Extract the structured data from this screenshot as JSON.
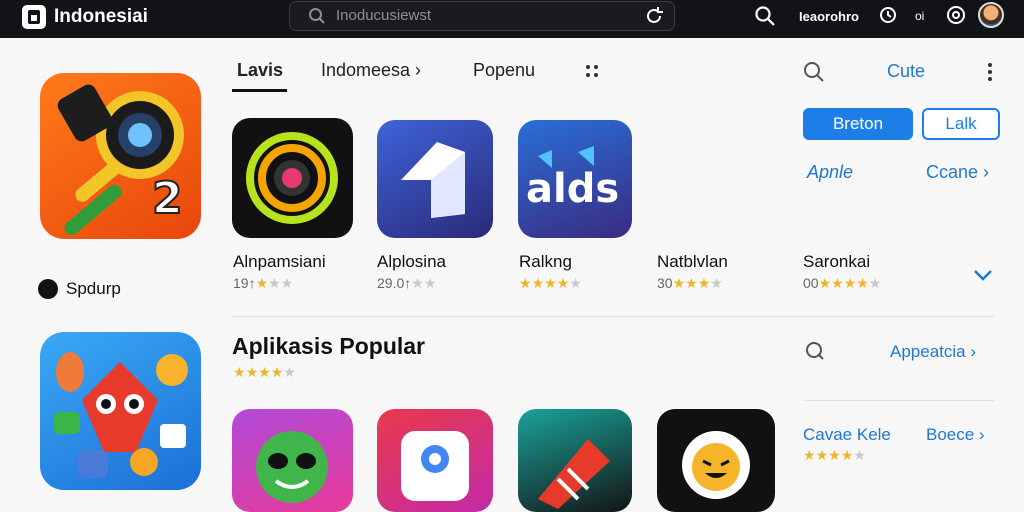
{
  "header": {
    "brand": "Indonesiai",
    "search_placeholder": "Inoducusiewst",
    "user_label": "Ieaorohro",
    "tiny_label": "oi"
  },
  "featured": {
    "sponsor_label": "Spdurp"
  },
  "tabs": [
    {
      "label": "Lavis",
      "active": true
    },
    {
      "label": "Indomeesa ›",
      "active": false
    },
    {
      "label": "Popenu",
      "active": false
    }
  ],
  "actions": {
    "cute_label": "Cute",
    "primary_button": "Breton",
    "secondary_button": "Lalk",
    "apple_link": "Apnle",
    "ccane_link": "Ccane ›"
  },
  "apps": [
    {
      "name": "Alnpamsiani",
      "rating_text": "19↑",
      "stars": 1,
      "max_stars": 3
    },
    {
      "name": "Alplosina",
      "rating_text": "29.0↑",
      "stars": 0,
      "max_stars": 2
    },
    {
      "name": "Ralkng",
      "rating_text": "",
      "stars": 4,
      "max_stars": 5
    },
    {
      "name": "Natblvlan",
      "rating_text": "30",
      "stars": 3,
      "max_stars": 4
    },
    {
      "name": "Saronkai",
      "rating_text": "00",
      "stars": 4,
      "max_stars": 5
    }
  ],
  "popular": {
    "title": "Aplikasis Popular",
    "stars": 4,
    "max_stars": 5,
    "see_all_link": "Appeatcia ›",
    "cavae_link": "Cavae Kele",
    "boece_link": "Boece ›",
    "cavae_stars": 4,
    "cavae_max_stars": 5
  },
  "colors": {
    "topbar": "#121316",
    "accent": "#1e7ee8",
    "star": "#f0b429"
  }
}
